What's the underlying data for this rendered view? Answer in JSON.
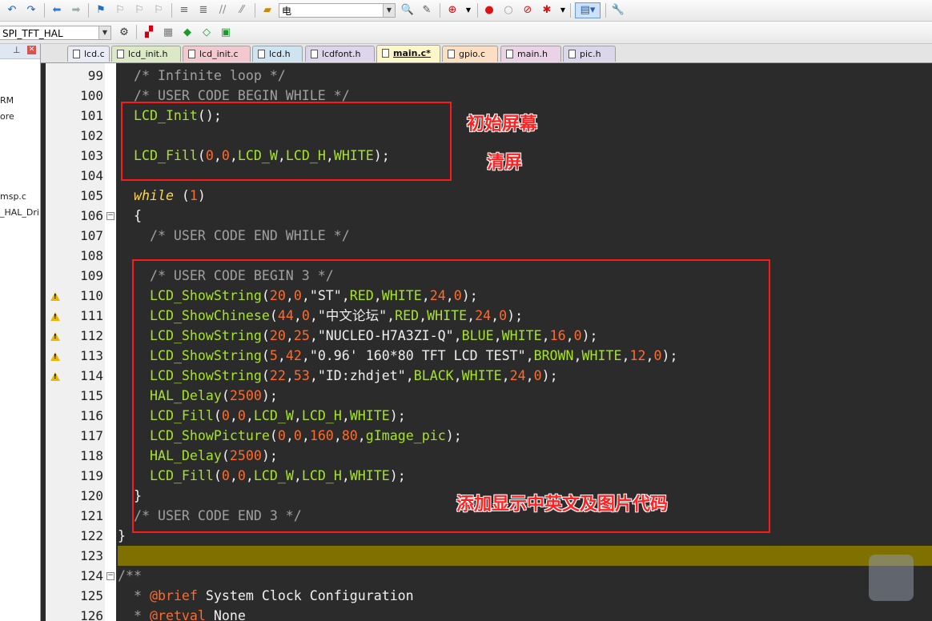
{
  "toolbar": {
    "target_select": "电",
    "project_select": "SPI_TFT_HAL"
  },
  "project_panel": {
    "pin_icon": "pin-icon",
    "close_icon": "close-icon",
    "items": [
      "RM",
      "ore",
      "msp.c",
      "_HAL_Dri"
    ]
  },
  "tabs": [
    {
      "label": "lcd.c",
      "color": "#e9ecf5"
    },
    {
      "label": "lcd_init.h",
      "color": "#dbe9c7"
    },
    {
      "label": "lcd_init.c",
      "color": "#f2c9cf"
    },
    {
      "label": "lcd.h",
      "color": "#cfe3f1"
    },
    {
      "label": "lcdfont.h",
      "color": "#ddd5ea"
    },
    {
      "label": "main.c*",
      "color": "#fdf6c8"
    },
    {
      "label": "gpio.c",
      "color": "#fadfc3"
    },
    {
      "label": "main.h",
      "color": "#ead3e6"
    },
    {
      "label": "pic.h",
      "color": "#dcd6ea"
    }
  ],
  "editor": {
    "line_numbers": [
      "99",
      "100",
      "101",
      "102",
      "103",
      "104",
      "105",
      "106",
      "107",
      "108",
      "109",
      "110",
      "111",
      "112",
      "113",
      "114",
      "115",
      "116",
      "117",
      "118",
      "119",
      "120",
      "121",
      "122",
      "123",
      "124",
      "125",
      "126"
    ],
    "lines": {
      "l99": "  /* Infinite loop */",
      "l100": "  /* USER CODE BEGIN WHILE */",
      "l101_fn": "LCD_Init",
      "l103_fn": "LCD_Fill",
      "l103_a": "0",
      "l103_b": "0",
      "l103_c": "LCD_W",
      "l103_d": "LCD_H",
      "l103_e": "WHITE",
      "l105_kw": "while",
      "l105_num": "1",
      "l107": "    /* USER CODE END WHILE */",
      "l109": "    /* USER CODE BEGIN 3 */",
      "l110": [
        "LCD_ShowString",
        "20",
        "0",
        "\"ST\"",
        "RED",
        "WHITE",
        "24",
        "0"
      ],
      "l111": [
        "LCD_ShowChinese",
        "44",
        "0",
        "\"中文论坛\"",
        "RED",
        "WHITE",
        "24",
        "0"
      ],
      "l112": [
        "LCD_ShowString",
        "20",
        "25",
        "\"NUCLEO-H7A3ZI-Q\"",
        "BLUE",
        "WHITE",
        "16",
        "0"
      ],
      "l113": [
        "LCD_ShowString",
        "5",
        "42",
        "\"0.96' 160*80 TFT LCD TEST\"",
        "BROWN",
        "WHITE",
        "12",
        "0"
      ],
      "l114": [
        "LCD_ShowString",
        "22",
        "53",
        "\"ID:zhdjet\"",
        "BLACK",
        "WHITE",
        "24",
        "0"
      ],
      "l115": [
        "HAL_Delay",
        "2500"
      ],
      "l116": [
        "LCD_Fill",
        "0",
        "0",
        "LCD_W",
        "LCD_H",
        "WHITE"
      ],
      "l117": [
        "LCD_ShowPicture",
        "0",
        "0",
        "160",
        "80",
        "gImage_pic"
      ],
      "l118": [
        "HAL_Delay",
        "2500"
      ],
      "l119": [
        "LCD_Fill",
        "0",
        "0",
        "LCD_W",
        "LCD_H",
        "WHITE"
      ],
      "l120": "  }",
      "l121": "  /* USER CODE END 3 */",
      "l122": "}",
      "l124": "/**",
      "l125_pre": "  * ",
      "l125_tag": "@brief",
      "l125_txt": " System Clock Configuration",
      "l126_pre": "  * ",
      "l126_tag": "@retval",
      "l126_txt": " None"
    },
    "warning_lines": [
      "110",
      "111",
      "112",
      "113",
      "114"
    ],
    "current_line": "123"
  },
  "annotations": {
    "init": "初始屏幕",
    "clear": "清屏",
    "added": "添加显示中英文及图片代码",
    "box_color": "#ff1a1a"
  }
}
